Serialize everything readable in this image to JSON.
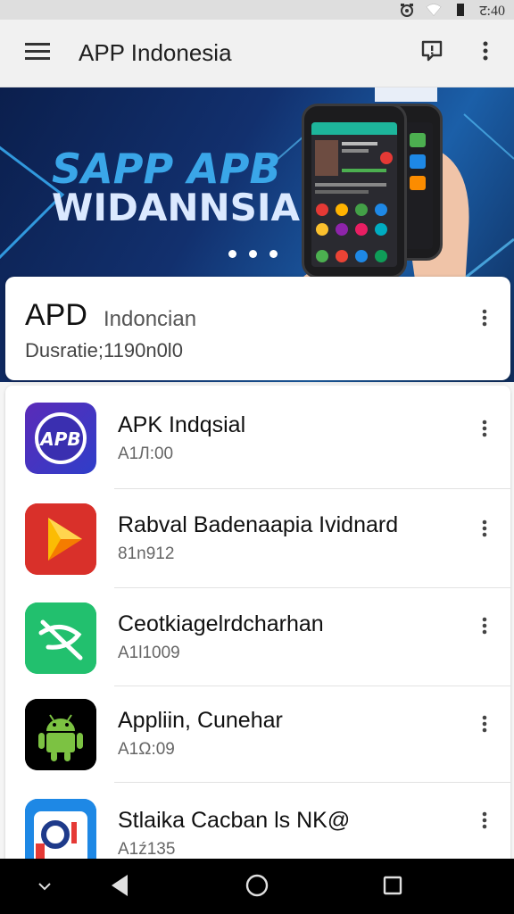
{
  "status_bar": {
    "time": "ट:40",
    "icons": [
      "alarm-icon",
      "wifi-icon",
      "battery-icon"
    ]
  },
  "app_bar": {
    "title": "APP Indonesia",
    "icons": [
      "menu-icon",
      "feedback-icon",
      "more-vert-icon"
    ]
  },
  "banner": {
    "line1": "SAPP APB",
    "line2": "WIDANNSIA",
    "slide_count": 3
  },
  "featured": {
    "name": "APD",
    "subtitle": "Indoncian",
    "meta": "Dusratie;1190n0l0"
  },
  "apps": [
    {
      "name": "APK Indqsial",
      "version": "A1Л:00",
      "icon": "apk-badge-icon",
      "icon_color": "#4a2fb8"
    },
    {
      "name": "Rabval Badenaapia Ividnard",
      "version": "81n912",
      "icon": "play-triangle-icon",
      "icon_color": "#e53935"
    },
    {
      "name": "Ceotkiagelrdcharhan",
      "version": "A1l1009",
      "icon": "crossed-tool-icon",
      "icon_color": "#1fbf6b"
    },
    {
      "name": "Appliin, Cunehar",
      "version": "A1Ω:09",
      "icon": "android-icon",
      "icon_color": "#000000"
    },
    {
      "name": "Stlaika Cacban ls NK@",
      "version": "A1ź135",
      "icon": "camera-app-icon",
      "icon_color": "#1e88e5"
    }
  ],
  "nav_bar": {
    "icons": [
      "chevron-down-icon",
      "back-icon",
      "home-icon",
      "recents-icon"
    ]
  }
}
